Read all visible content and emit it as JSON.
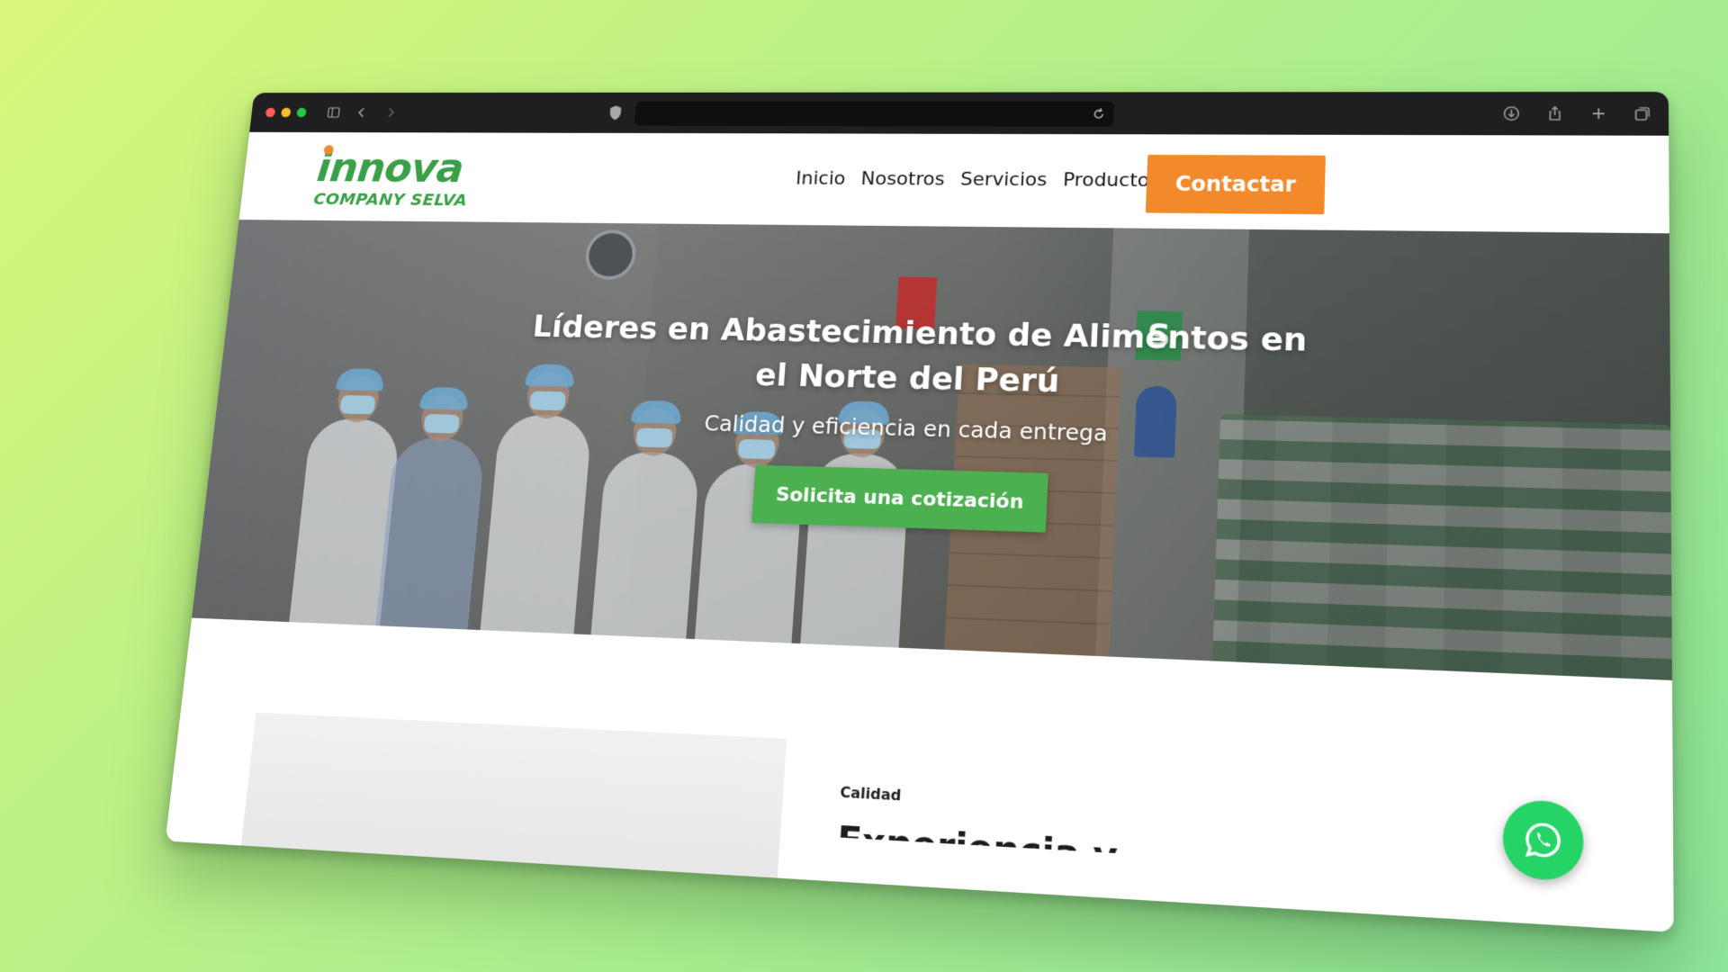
{
  "browser": {
    "url": "",
    "controls": {
      "sidebar_icon": "sidebar-icon",
      "back_icon": "chevron-left-icon",
      "forward_icon": "chevron-right-icon",
      "privacy_icon": "shield-icon",
      "reload_icon": "reload-icon",
      "download_icon": "download-icon",
      "share_icon": "share-icon",
      "new_tab_icon": "plus-icon",
      "tabs_icon": "tabs-overview-icon"
    }
  },
  "site": {
    "logo": {
      "word": "innova",
      "subtitle": "COMPANY SELVA"
    },
    "nav": [
      {
        "label": "Inicio"
      },
      {
        "label": "Nosotros"
      },
      {
        "label": "Servicios"
      },
      {
        "label": "Productos"
      }
    ],
    "contact_label": "Contactar"
  },
  "hero": {
    "title": "Líderes en Abastecimiento de Alimentos en el Norte del Perú",
    "subtitle": "Calidad y eficiencia en cada entrega",
    "cta_label": "Solicita una cotización",
    "sign_s": "S"
  },
  "section": {
    "eyebrow": "Calidad",
    "title_partial": "Experiencia y Variedad"
  },
  "colors": {
    "brand_green": "#3aa047",
    "cta_green": "#4caf50",
    "accent_orange": "#f28a2c",
    "whatsapp": "#25d366"
  }
}
